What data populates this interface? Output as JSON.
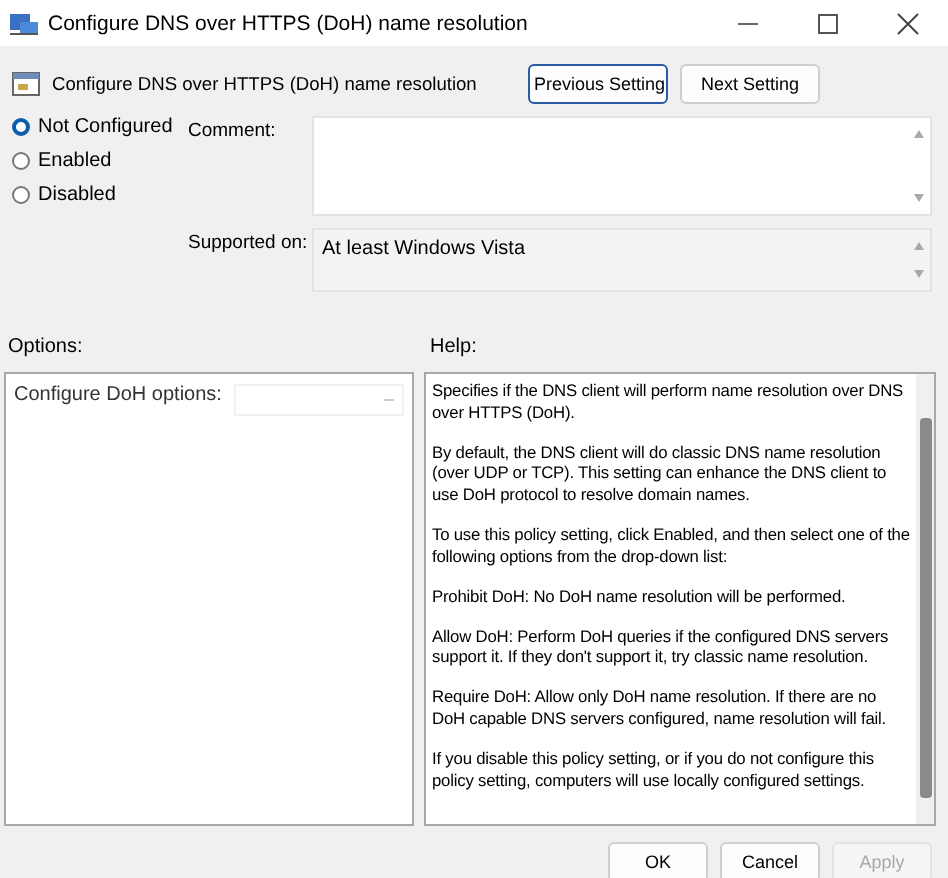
{
  "window": {
    "title": "Configure DNS over HTTPS (DoH) name resolution"
  },
  "header": {
    "title": "Configure DNS over HTTPS (DoH) name resolution",
    "buttons": [
      {
        "label": "Previous Setting",
        "focused": true
      },
      {
        "label": "Next Setting",
        "focused": false
      }
    ]
  },
  "state_options": [
    {
      "label": "Not Configured",
      "selected": true
    },
    {
      "label": "Enabled",
      "selected": false
    },
    {
      "label": "Disabled",
      "selected": false
    }
  ],
  "comment": {
    "label": "Comment:"
  },
  "supported_on": {
    "label": "Supported on:",
    "value": "At least Windows Vista"
  },
  "options": {
    "label": "Options:",
    "items": [
      {
        "label": "Configure DoH options:",
        "disabled": true
      }
    ]
  },
  "help": {
    "label": "Help:",
    "paragraphs": [
      "Specifies if the DNS client will perform name resolution over DNS over HTTPS (DoH).",
      "By default, the DNS client will do classic DNS name resolution (over UDP or TCP). This setting can enhance the DNS client to use DoH protocol to resolve domain names.",
      "To use this policy setting, click Enabled, and then select one of the following options from the drop-down list:",
      "Prohibit DoH: No DoH name resolution will be performed.",
      "Allow DoH: Perform DoH queries if the configured DNS servers support it. If they don't support it, try classic name resolution.",
      "Require DoH: Allow only DoH name resolution. If there are no DoH capable DNS servers configured, name resolution will fail.",
      "If you disable this policy setting, or if you do not configure this policy setting, computers will use locally configured settings."
    ]
  },
  "footer_buttons": [
    {
      "label": "OK",
      "disabled": false
    },
    {
      "label": "Cancel",
      "disabled": false
    },
    {
      "label": "Apply",
      "disabled": true
    }
  ]
}
